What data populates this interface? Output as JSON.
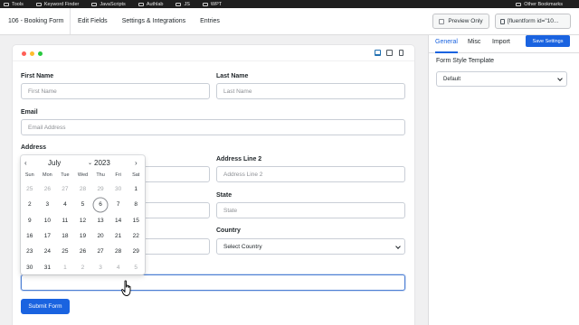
{
  "bookmarks": {
    "items": [
      "Tools",
      "Keyword Finder",
      "JavaScripts",
      "Authlab",
      "JS",
      "WPT"
    ],
    "other": "Other Bookmarks"
  },
  "header": {
    "form_title": "106 - Booking Form",
    "nav": [
      "Edit Fields",
      "Settings & Integrations",
      "Entries"
    ],
    "preview_label": "Preview Only",
    "shortcode": "[fluentform id=\"10..."
  },
  "form": {
    "first_name": {
      "label": "First Name",
      "placeholder": "First Name"
    },
    "last_name": {
      "label": "Last Name",
      "placeholder": "Last Name"
    },
    "email": {
      "label": "Email",
      "placeholder": "Email Address"
    },
    "address_label": "Address",
    "address_line_2": {
      "label": "Address Line 2",
      "placeholder": "Address Line 2"
    },
    "state": {
      "label": "State",
      "placeholder": "State"
    },
    "country": {
      "label": "Country",
      "value": "Select Country"
    },
    "submit_label": "Submit Form"
  },
  "datepicker": {
    "month": "July",
    "year": "2023",
    "weekdays": [
      "Sun",
      "Mon",
      "Tue",
      "Wed",
      "Thu",
      "Fri",
      "Sat"
    ],
    "days": [
      {
        "d": "25",
        "muted": true
      },
      {
        "d": "26",
        "muted": true
      },
      {
        "d": "27",
        "muted": true
      },
      {
        "d": "28",
        "muted": true
      },
      {
        "d": "29",
        "muted": true
      },
      {
        "d": "30",
        "muted": true
      },
      {
        "d": "1",
        "muted": false
      },
      {
        "d": "2",
        "muted": false
      },
      {
        "d": "3",
        "muted": false
      },
      {
        "d": "4",
        "muted": false
      },
      {
        "d": "5",
        "muted": false
      },
      {
        "d": "6",
        "muted": false,
        "today": true
      },
      {
        "d": "7",
        "muted": false
      },
      {
        "d": "8",
        "muted": false
      },
      {
        "d": "9",
        "muted": false
      },
      {
        "d": "10",
        "muted": false
      },
      {
        "d": "11",
        "muted": false
      },
      {
        "d": "12",
        "muted": false
      },
      {
        "d": "13",
        "muted": false
      },
      {
        "d": "14",
        "muted": false
      },
      {
        "d": "15",
        "muted": false
      },
      {
        "d": "16",
        "muted": false
      },
      {
        "d": "17",
        "muted": false
      },
      {
        "d": "18",
        "muted": false
      },
      {
        "d": "19",
        "muted": false
      },
      {
        "d": "20",
        "muted": false
      },
      {
        "d": "21",
        "muted": false
      },
      {
        "d": "22",
        "muted": false
      },
      {
        "d": "23",
        "muted": false
      },
      {
        "d": "24",
        "muted": false
      },
      {
        "d": "25",
        "muted": false
      },
      {
        "d": "26",
        "muted": false
      },
      {
        "d": "27",
        "muted": false
      },
      {
        "d": "28",
        "muted": false
      },
      {
        "d": "29",
        "muted": false
      },
      {
        "d": "30",
        "muted": false
      },
      {
        "d": "31",
        "muted": false
      },
      {
        "d": "1",
        "muted": true
      },
      {
        "d": "2",
        "muted": true
      },
      {
        "d": "3",
        "muted": true
      },
      {
        "d": "4",
        "muted": true
      },
      {
        "d": "5",
        "muted": true
      }
    ]
  },
  "sidebar": {
    "tabs": [
      "General",
      "Misc",
      "Import"
    ],
    "save_label": "Save Settings",
    "style_label": "Form Style Template",
    "style_value": "Default"
  },
  "colors": {
    "accent": "#1a63e0",
    "bookmarks_bg": "#1f1f1f"
  }
}
